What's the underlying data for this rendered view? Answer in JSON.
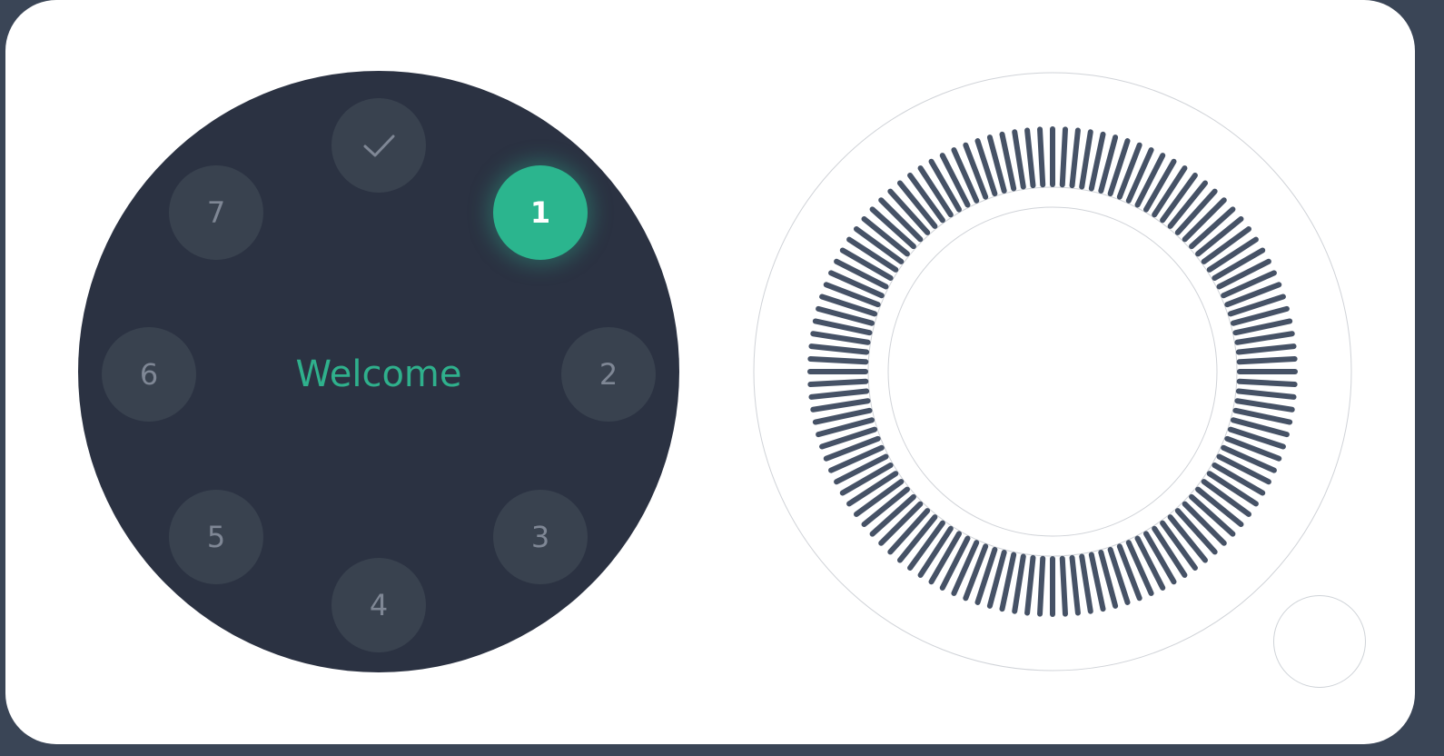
{
  "colors": {
    "frame": "#3a4556",
    "panel": "#ffffff",
    "keypad_bg": "#2b3242",
    "key_bg": "#39424f",
    "key_text": "#7f8795",
    "accent": "#2bb58e",
    "dial_tick": "#465266",
    "dial_ring_line": "#d0d3d8"
  },
  "keypad": {
    "welcome_text": "Welcome",
    "keys": [
      {
        "label": "1",
        "active": true
      },
      {
        "label": "2",
        "active": false
      },
      {
        "label": "3",
        "active": false
      },
      {
        "label": "4",
        "active": false
      },
      {
        "label": "5",
        "active": false
      },
      {
        "label": "6",
        "active": false
      },
      {
        "label": "7",
        "active": false
      }
    ],
    "confirm_icon": "check-icon"
  },
  "dial": {
    "tick_count": 120
  }
}
